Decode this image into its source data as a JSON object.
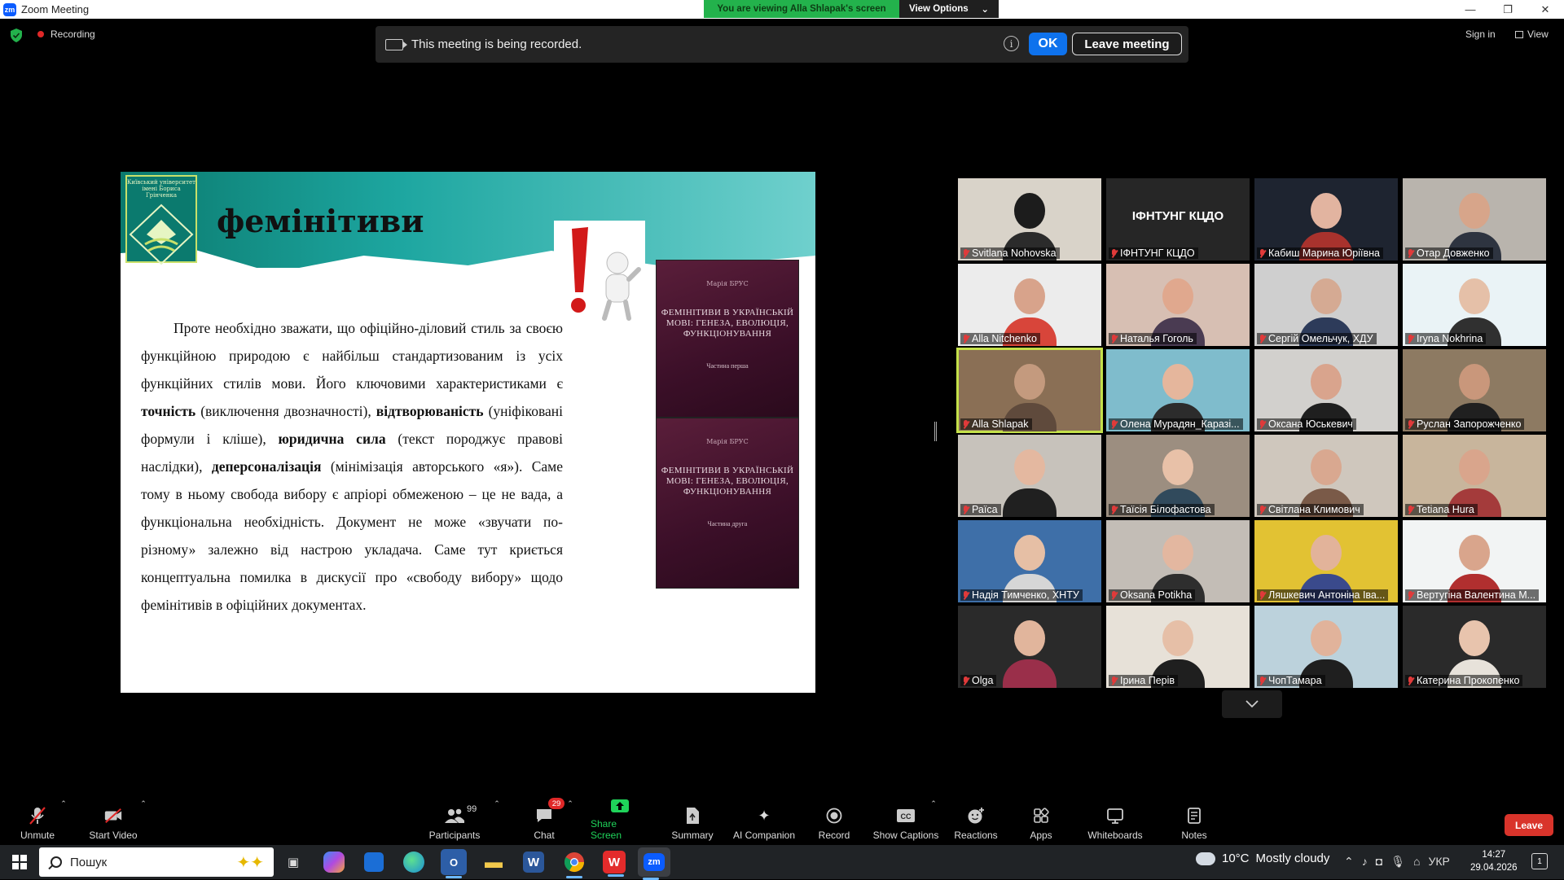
{
  "window": {
    "app_badge": "zm",
    "title": "Zoom Meeting"
  },
  "viewing_banner": {
    "message": "You are viewing Alla Shlapak's screen",
    "options_label": "View Options"
  },
  "status": {
    "recording_label": "Recording"
  },
  "recording_notice": {
    "message": "This meeting is being recorded.",
    "ok_label": "OK",
    "leave_label": "Leave meeting"
  },
  "top_right": {
    "signin_label": "Sign in",
    "view_label": "View"
  },
  "slide": {
    "logo_text": "Київський університет імені Бориса Грінченка",
    "title": "фемінітиви",
    "body_plain_1": "Проте необхідно зважати, що офіційно-діловий стиль за своєю функційною природою є найбільш стандартизованим із усіх функційних стилів мови. Його ключовими характеристиками є ",
    "bold_1": "точність",
    "body_plain_2": " (виключення двозначності), ",
    "bold_2": "відтворюваність",
    "body_plain_3": " (уніфіковані формули і кліше), ",
    "bold_3": "юридична сила",
    "body_plain_4": " (текст породжує правові наслідки), ",
    "bold_4": "деперсоналізація",
    "body_plain_5": " (мінімізація авторського «я»). Саме тому в ньому свобода вибору є апріорі обмеженою – це не вада, а функціональна необхідність. Документ не може «звучати по-різному» залежно від настрою укладача. Саме тут криється концептуальна помилка в дискусії про «свободу вибору» щодо фемінітивів в офіційних документах.",
    "book1": {
      "author": "Марія БРУС",
      "title": "ФЕМІНІТИВИ В УКРАЇНСЬКІЙ МОВІ: ГЕНЕЗА, ЕВОЛЮЦІЯ, ФУНКЦІОНУВАННЯ",
      "part": "Частина перша"
    },
    "book2": {
      "author": "Марія БРУС",
      "title": "ФЕМІНІТИВИ В УКРАЇНСЬКІЙ МОВІ: ГЕНЕЗА, ЕВОЛЮЦІЯ, ФУНКЦІОНУВАННЯ",
      "part": "Частина друга"
    }
  },
  "participants": [
    {
      "name": "Svitlana Nohovska",
      "bg": "#d9d3c9",
      "skin": "#1c1c1c",
      "shirt": "#2b2b2b"
    },
    {
      "name": "ІФНТУНГ КЦДО",
      "bg": "#262626",
      "label": "ІФНТУНГ КЦДО"
    },
    {
      "name": "Кабиш Марина Юріївна",
      "bg": "#1e2430",
      "skin": "#e2b4a0",
      "shirt": "#a8322d"
    },
    {
      "name": "Отар Довженко",
      "bg": "#b9b4ad",
      "skin": "#d7a58a",
      "shirt": "#2e3440"
    },
    {
      "name": "Alla Nitchenko",
      "bg": "#ececec",
      "skin": "#d8a38b",
      "shirt": "#d8453a"
    },
    {
      "name": "Наталья Гоголь",
      "bg": "#d7bfb3",
      "skin": "#e0a88e",
      "shirt": "#4a3b52"
    },
    {
      "name": "Сергій Омельчук, ХДУ",
      "bg": "#cfcfcf",
      "skin": "#d5aa93",
      "shirt": "#2d3b5a"
    },
    {
      "name": "Iryna Nokhrina",
      "bg": "#eaf3f6",
      "skin": "#e5c0a8",
      "shirt": "#303030"
    },
    {
      "name": "Alla Shlapak",
      "bg": "#8a6f55",
      "skin": "#c49a7e",
      "shirt": "#5f4a3c"
    },
    {
      "name": "Олена Мурадян_Каразі...",
      "bg": "#7fbccc",
      "skin": "#e5b69c",
      "shirt": "#2c2c2c"
    },
    {
      "name": "Оксана Юськевич",
      "bg": "#d2d0cd",
      "skin": "#d9a48d",
      "shirt": "#1f1f1f"
    },
    {
      "name": "Руслан Запорожченко",
      "bg": "#8d7a62",
      "skin": "#c9977b",
      "shirt": "#202020"
    },
    {
      "name": "Раїса",
      "bg": "#c7c2bb",
      "skin": "#e4b8a0",
      "shirt": "#202020"
    },
    {
      "name": "Таїсія Білофастова",
      "bg": "#9c8e80",
      "skin": "#e8c1a8",
      "shirt": "#314a5c"
    },
    {
      "name": "Світлана Климович",
      "bg": "#cfc7bd",
      "skin": "#d9a890",
      "shirt": "#7a5a48"
    },
    {
      "name": "Tetiana Hura",
      "bg": "#c8b59c",
      "skin": "#d9a58c",
      "shirt": "#a43b3b"
    },
    {
      "name": "Надія Тимченко, ХНТУ",
      "bg": "#3e6fa8",
      "skin": "#e6bfa5",
      "shirt": "#d6d6d6"
    },
    {
      "name": "Oksana Potikha",
      "bg": "#c3bdb6",
      "skin": "#e3b7a0",
      "shirt": "#2e2e2e"
    },
    {
      "name": "Ляшкевич Антоніна Іва...",
      "bg": "#e2c233",
      "skin": "#e2b39a",
      "shirt": "#3a4a8c"
    },
    {
      "name": "Вертугіна Валентина М...",
      "bg": "#f2f4f4",
      "skin": "#d9a58c",
      "shirt": "#b12f2f"
    },
    {
      "name": "Olga",
      "bg": "#2a2a2a",
      "skin": "#e1b59c",
      "shirt": "#9a2f4a"
    },
    {
      "name": "Ірина Перів",
      "bg": "#e7e1d8",
      "skin": "#e6bfa7",
      "shirt": "#1f1f1f"
    },
    {
      "name": "ЧопТамара",
      "bg": "#bcd2dc",
      "skin": "#e1b39b",
      "shirt": "#1f1f1f"
    },
    {
      "name": "Катерина Прокопенко",
      "bg": "#2a2a2a",
      "skin": "#e8c4ad",
      "shirt": "#e7e2da"
    }
  ],
  "toolbar": {
    "unmute": "Unmute",
    "start_video": "Start Video",
    "participants": "Participants",
    "participants_count": "99",
    "chat": "Chat",
    "chat_badge": "29",
    "share_screen": "Share Screen",
    "summary": "Summary",
    "ai_companion": "AI Companion",
    "record": "Record",
    "show_captions": "Show Captions",
    "reactions": "Reactions",
    "apps": "Apps",
    "whiteboards": "Whiteboards",
    "notes": "Notes",
    "leave": "Leave",
    "share_color": "#1fd35a"
  },
  "taskbar": {
    "search_placeholder": "Пошук",
    "weather_temp": "10°C",
    "weather_text": "Mostly cloudy",
    "lang": "УКР",
    "time": "14:27",
    "date": "29.04.2026",
    "notifications": "1"
  }
}
